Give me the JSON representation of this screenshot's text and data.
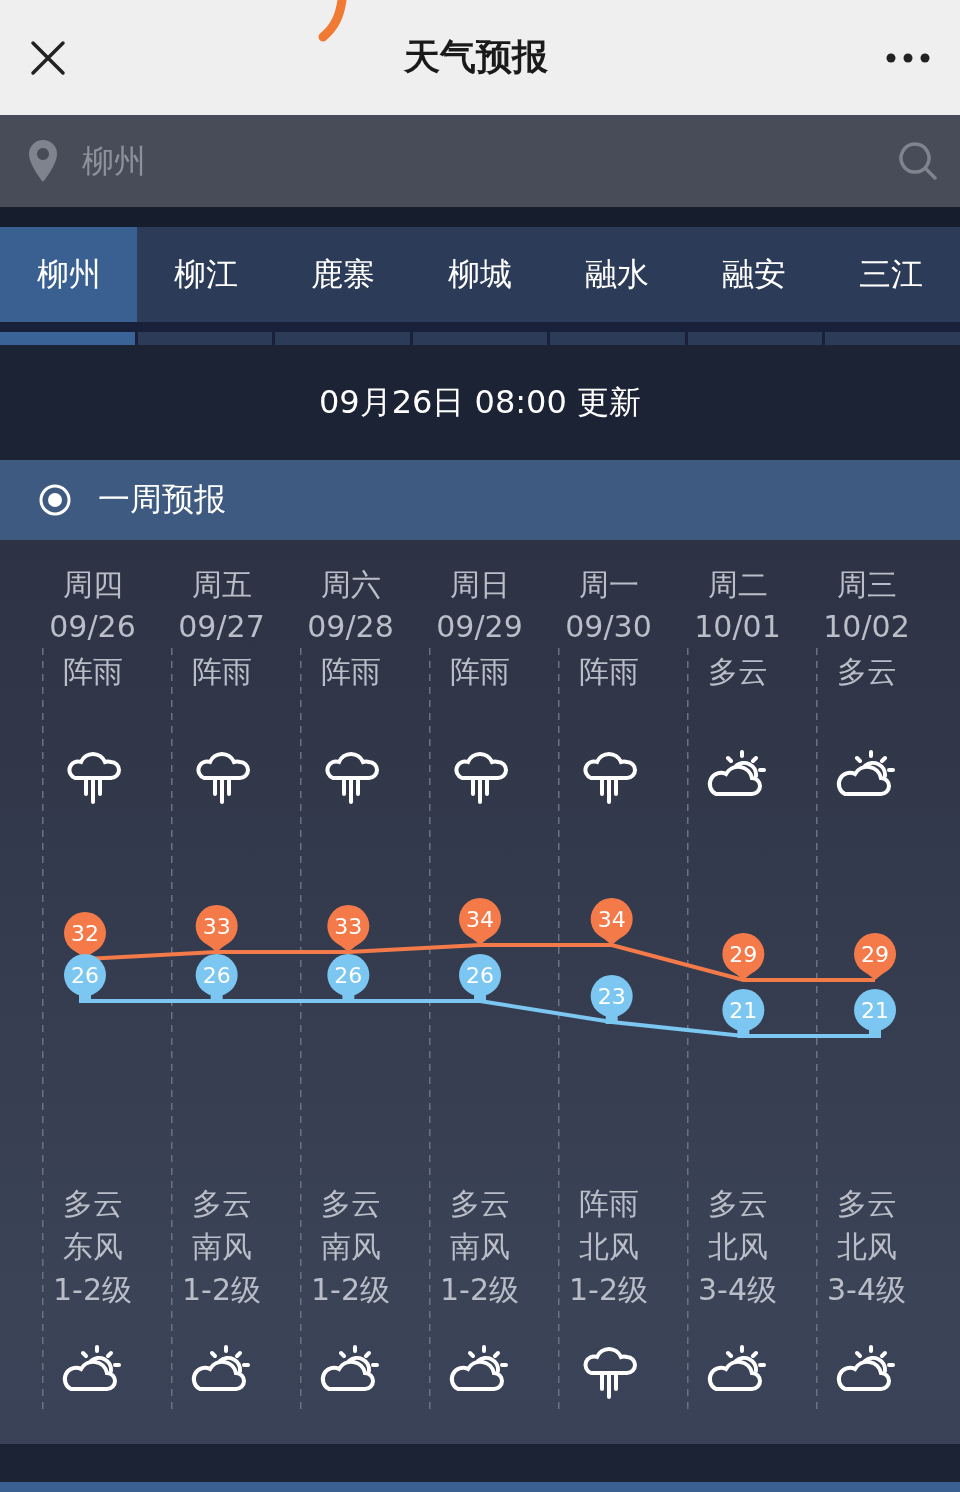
{
  "header": {
    "title": "天气预报"
  },
  "search": {
    "placeholder": "柳州"
  },
  "tabs": [
    {
      "label": "柳州",
      "selected": true
    },
    {
      "label": "柳江",
      "selected": false
    },
    {
      "label": "鹿寨",
      "selected": false
    },
    {
      "label": "柳城",
      "selected": false
    },
    {
      "label": "融水",
      "selected": false
    },
    {
      "label": "融安",
      "selected": false
    },
    {
      "label": "三江",
      "selected": false
    }
  ],
  "update": {
    "text": "09月26日 08:00 更新"
  },
  "section": {
    "title": "一周预报"
  },
  "days": [
    {
      "weekday": "周四",
      "date": "09/26",
      "day": {
        "kind": "rain",
        "weather": "阵雨"
      },
      "high": "32",
      "low": "26",
      "night": {
        "kind": "partly-cloudy",
        "weather": "多云",
        "wind": "东风",
        "level_text": "1-2级"
      }
    },
    {
      "weekday": "周五",
      "date": "09/27",
      "day": {
        "kind": "rain",
        "weather": "阵雨"
      },
      "high": "33",
      "low": "26",
      "night": {
        "kind": "partly-cloudy",
        "weather": "多云",
        "wind": "南风",
        "level_text": "1-2级"
      }
    },
    {
      "weekday": "周六",
      "date": "09/28",
      "day": {
        "kind": "rain",
        "weather": "阵雨"
      },
      "high": "33",
      "low": "26",
      "night": {
        "kind": "partly-cloudy",
        "weather": "多云",
        "wind": "南风",
        "level_text": "1-2级"
      }
    },
    {
      "weekday": "周日",
      "date": "09/29",
      "day": {
        "kind": "rain",
        "weather": "阵雨"
      },
      "high": "34",
      "low": "26",
      "night": {
        "kind": "partly-cloudy",
        "weather": "多云",
        "wind": "南风",
        "level_text": "1-2级"
      }
    },
    {
      "weekday": "周一",
      "date": "09/30",
      "day": {
        "kind": "rain",
        "weather": "阵雨"
      },
      "high": "34",
      "low": "23",
      "night": {
        "kind": "rain",
        "weather": "阵雨",
        "wind": "北风",
        "level_text": "1-2级"
      }
    },
    {
      "weekday": "周二",
      "date": "10/01",
      "day": {
        "kind": "partly-cloudy",
        "weather": "多云"
      },
      "high": "29",
      "low": "21",
      "night": {
        "kind": "partly-cloudy",
        "weather": "多云",
        "wind": "北风",
        "level_text": "3-4级"
      }
    },
    {
      "weekday": "周三",
      "date": "10/02",
      "day": {
        "kind": "partly-cloudy",
        "weather": "多云"
      },
      "high": "29",
      "low": "21",
      "night": {
        "kind": "partly-cloudy",
        "weather": "多云",
        "wind": "北风",
        "level_text": "3-4级"
      }
    }
  ]
}
